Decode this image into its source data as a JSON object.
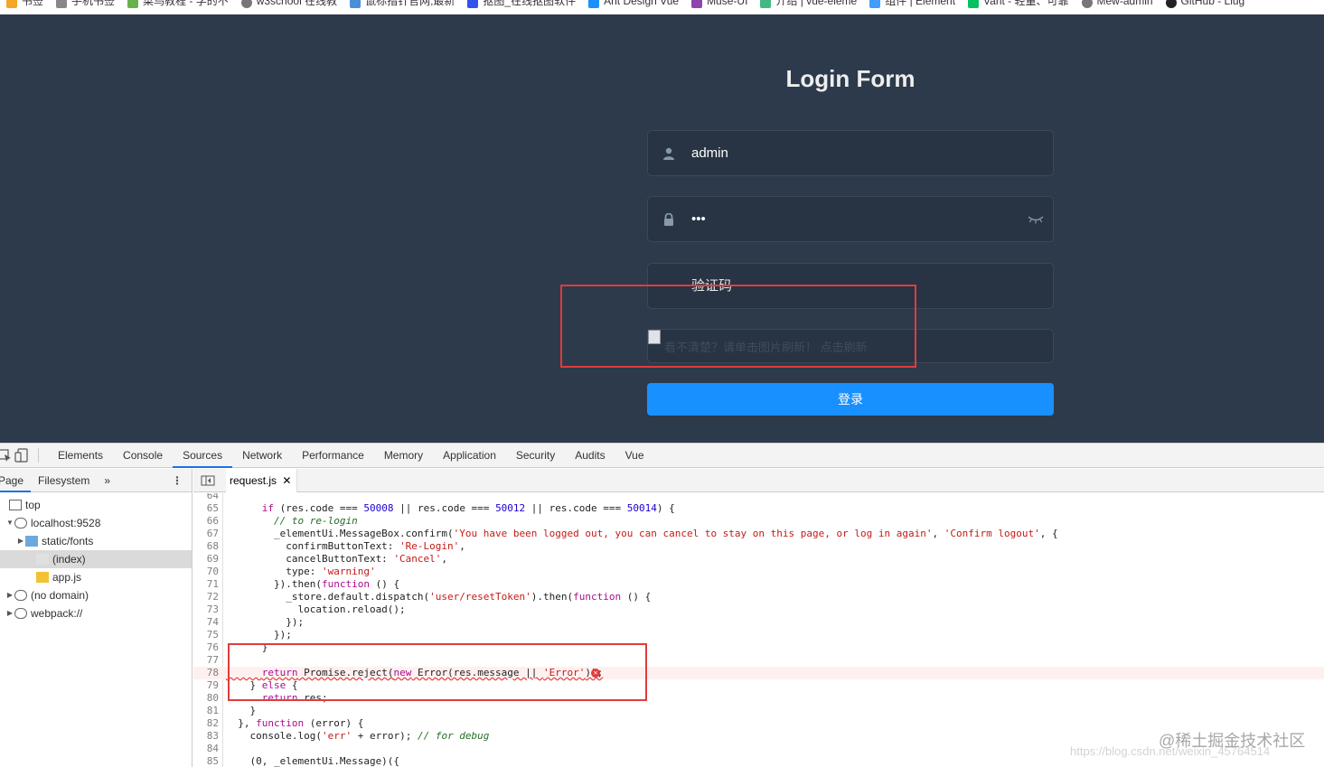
{
  "bookmarks": [
    {
      "label": "书签",
      "icon": "star-icon",
      "color": "#f5a623"
    },
    {
      "label": "手机书签",
      "icon": "folder-icon",
      "color": "#888888"
    },
    {
      "label": "菜鸟教程 - 学的不",
      "icon": "site-icon",
      "color": "#6ab04c"
    },
    {
      "label": "w3school 在线教",
      "icon": "globe-icon",
      "color": "#777777"
    },
    {
      "label": "鼠标指针官网,最新",
      "icon": "site-icon",
      "color": "#4a90d9"
    },
    {
      "label": "抠图_在线抠图软件",
      "icon": "site-icon",
      "color": "#2f54eb"
    },
    {
      "label": "Ant Design Vue",
      "icon": "site-icon",
      "color": "#1890ff"
    },
    {
      "label": "Muse-UI",
      "icon": "site-icon",
      "color": "#8e44ad"
    },
    {
      "label": "介绍 | vue-eleme",
      "icon": "site-icon",
      "color": "#42b983"
    },
    {
      "label": "组件 | Element",
      "icon": "site-icon",
      "color": "#409eff"
    },
    {
      "label": "Vant - 轻量、可靠",
      "icon": "site-icon",
      "color": "#07c160"
    },
    {
      "label": "Mew-admin",
      "icon": "globe-icon",
      "color": "#777777"
    },
    {
      "label": "GitHub - Liug",
      "icon": "github-icon",
      "color": "#222222"
    }
  ],
  "login": {
    "title": "Login Form",
    "username": "admin",
    "password": "•••",
    "captcha_placeholder": "验证码",
    "captcha_image_alt": "看不清楚？请单击图片刷新！ 点击刷新",
    "submit_label": "登录",
    "accent": "#1890ff",
    "background": "#2d3a4b"
  },
  "devtools": {
    "tabs": [
      "Elements",
      "Console",
      "Sources",
      "Network",
      "Performance",
      "Memory",
      "Application",
      "Security",
      "Audits",
      "Vue"
    ],
    "active_tab": "Sources",
    "navigator_tabs": [
      "Page",
      "Filesystem",
      "»"
    ],
    "tree": [
      {
        "label": "top",
        "icon": "frame-icon"
      },
      {
        "label": "localhost:9528",
        "icon": "cloud-icon"
      },
      {
        "label": "static/fonts",
        "icon": "folder-icon"
      },
      {
        "label": "(index)",
        "icon": "file-icon"
      },
      {
        "label": "app.js",
        "icon": "js-file-icon"
      },
      {
        "label": "(no domain)",
        "icon": "cloud-icon"
      },
      {
        "label": "webpack://",
        "icon": "cloud-icon"
      }
    ],
    "open_file": "request.js",
    "code": [
      {
        "n": "64",
        "text": ""
      },
      {
        "n": "65",
        "text": "      if (res.code === 50008 || res.code === 50012 || res.code === 50014) {"
      },
      {
        "n": "66",
        "text": "        // to re-login"
      },
      {
        "n": "67",
        "text": "        _elementUi.MessageBox.confirm('You have been logged out, you can cancel to stay on this page, or log in again', 'Confirm logout', {"
      },
      {
        "n": "68",
        "text": "          confirmButtonText: 'Re-Login',"
      },
      {
        "n": "69",
        "text": "          cancelButtonText: 'Cancel',"
      },
      {
        "n": "70",
        "text": "          type: 'warning'"
      },
      {
        "n": "71",
        "text": "        }).then(function () {"
      },
      {
        "n": "72",
        "text": "          _store.default.dispatch('user/resetToken').then(function () {"
      },
      {
        "n": "73",
        "text": "            location.reload();"
      },
      {
        "n": "74",
        "text": "          });"
      },
      {
        "n": "75",
        "text": "        });"
      },
      {
        "n": "76",
        "text": "      }"
      },
      {
        "n": "77",
        "text": ""
      },
      {
        "n": "78",
        "text": "      return Promise.reject(new Error(res.message || 'Error'));"
      },
      {
        "n": "79",
        "text": "    } else {"
      },
      {
        "n": "80",
        "text": "      return res;"
      },
      {
        "n": "81",
        "text": "    }"
      },
      {
        "n": "82",
        "text": "  }, function (error) {"
      },
      {
        "n": "83",
        "text": "    console.log('err' + error); // for debug"
      },
      {
        "n": "84",
        "text": ""
      },
      {
        "n": "85",
        "text": "    (0, _elementUi.Message)({"
      }
    ],
    "error_line": "78"
  },
  "watermarks": {
    "site": "@稀土掘金技术社区",
    "url": "https://blog.csdn.net/weixin_45764514"
  }
}
